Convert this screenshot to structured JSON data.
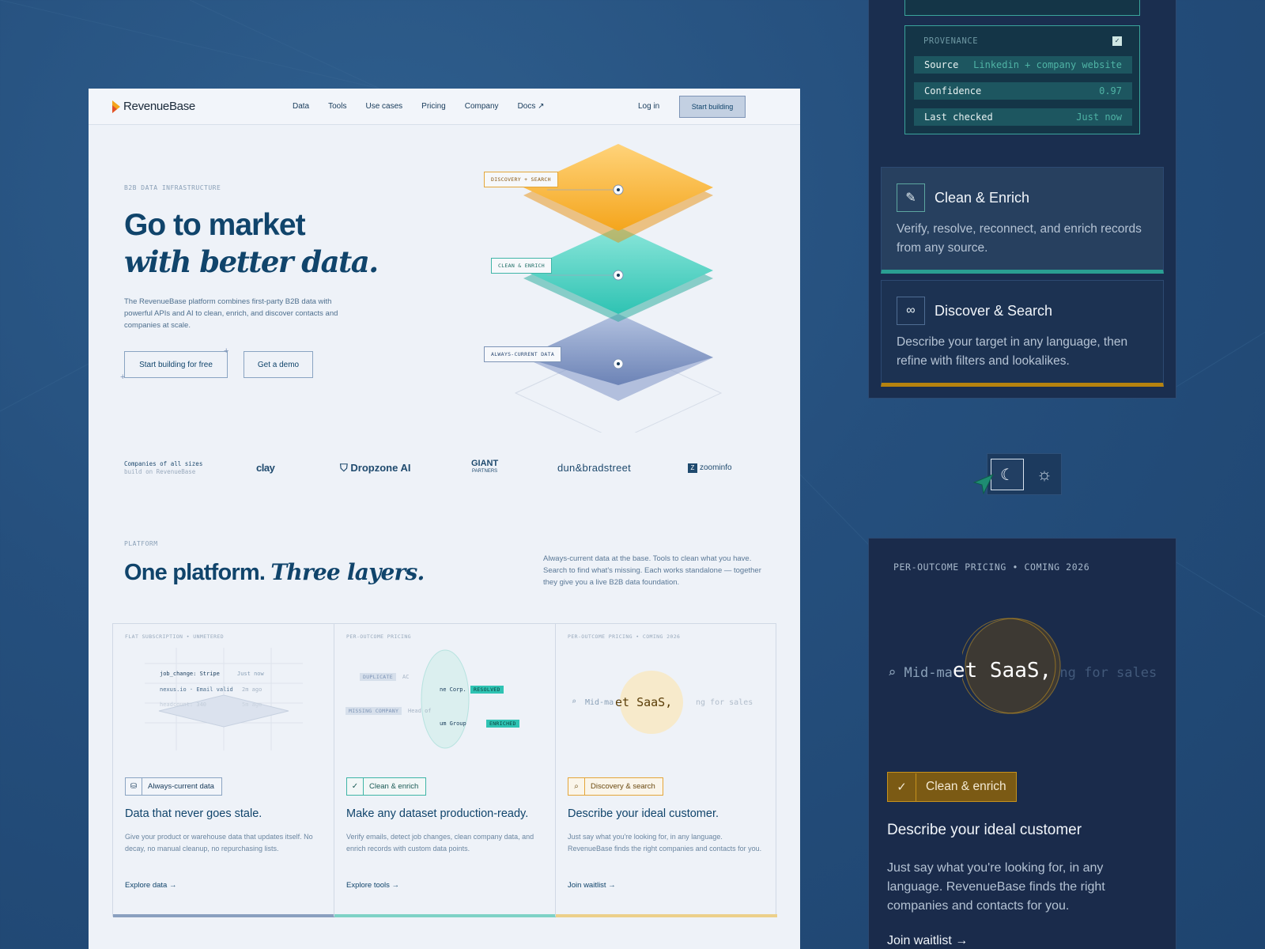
{
  "nav": {
    "brand": "RevenueBase",
    "links": [
      "Data",
      "Tools",
      "Use cases",
      "Pricing",
      "Company"
    ],
    "docs": "Docs ↗",
    "login": "Log in",
    "cta": "Start building"
  },
  "hero": {
    "eyebrow": "B2B DATA INFRASTRUCTURE",
    "title_line1": "Go to market",
    "title_line2": "with better data.",
    "subtitle": "The RevenueBase platform combines first-party B2B data with powerful APIs and AI to clean, enrich, and discover contacts and companies at scale.",
    "primary_button": "Start building for free",
    "secondary_button": "Get a demo",
    "stack_labels": [
      "DISCOVERY + SEARCH",
      "CLEAN & ENRICH",
      "ALWAYS-CURRENT DATA"
    ]
  },
  "logos": {
    "caption_line1": "Companies of all sizes",
    "caption_line2": "build on RevenueBase",
    "brands": [
      "clay",
      "Dropzone AI",
      "GIANT",
      "PARTNERS",
      "dun&bradstreet",
      "zoominfo"
    ]
  },
  "platform": {
    "eyebrow": "PLATFORM",
    "title_plain": "One platform. ",
    "title_italic": "Three layers.",
    "description": "Always-current data at the base. Tools to clean what you have. Search to find what's missing. Each works standalone — together they give you a live B2B data foundation."
  },
  "cards": [
    {
      "eyebrow": "FLAT SUBSCRIPTION • UNMETERED",
      "badge": "Always-current data",
      "title": "Data that never goes stale.",
      "text": "Give your product or warehouse data that updates itself. No decay, no manual cleanup, no repurchasing lists.",
      "link": "Explore data  →",
      "mock": [
        "job_change: Stripe",
        "Just now",
        "nexus.io · Email valid",
        "2m ago",
        "headcount: 340",
        "5m ago"
      ]
    },
    {
      "eyebrow": "PER-OUTCOME PRICING",
      "badge": "Clean & enrich",
      "title": "Make any dataset production-ready.",
      "text": "Verify emails, detect job changes, clean company data, and enrich records with custom data points.",
      "link": "Explore tools  →",
      "mock": [
        "DUPLICATE",
        "AC",
        "ne Corp.",
        "RESOLVED",
        "MISSING COMPANY",
        "Head of",
        "um Group",
        "ENRICHED"
      ]
    },
    {
      "eyebrow": "PER-OUTCOME PRICING • COMING 2026",
      "badge": "Discovery & search",
      "title": "Describe your ideal customer.",
      "text": "Just say what you're looking for, in any language. RevenueBase finds the right companies and contacts for you.",
      "link": "Join waitlist  →",
      "mock": [
        "Mid-ma",
        "et SaaS,",
        "ng for sales"
      ]
    }
  ],
  "provenance": {
    "header": "PROVENANCE",
    "rows": [
      {
        "key": "Source",
        "value": "Linkedin + company website"
      },
      {
        "key": "Confidence",
        "value": "0.97"
      },
      {
        "key": "Last checked",
        "value": "Just now"
      }
    ]
  },
  "features": [
    {
      "title": "Clean & Enrich",
      "text": "Verify, resolve, reconnect, and enrich records from any source."
    },
    {
      "title": "Discover & Search",
      "text": "Describe your target in any language, then refine with filters and lookalikes."
    }
  ],
  "pricing_panel": {
    "eyebrow": "PER-OUTCOME PRICING • COMING 2026",
    "search_left": "Mid-ma",
    "search_focus": "et SaaS,",
    "search_right": "ng for sales",
    "badge": "Clean & enrich",
    "title": "Describe your ideal customer",
    "text": "Just say what you're looking for, in any language. RevenueBase finds the right companies and contacts for you.",
    "link": "Join waitlist  →"
  },
  "colors": {
    "navy": "#10446b",
    "amber": "#f4a51c",
    "teal": "#2fc3b3",
    "slate": "#7b90c0",
    "background": "#254f7d"
  }
}
